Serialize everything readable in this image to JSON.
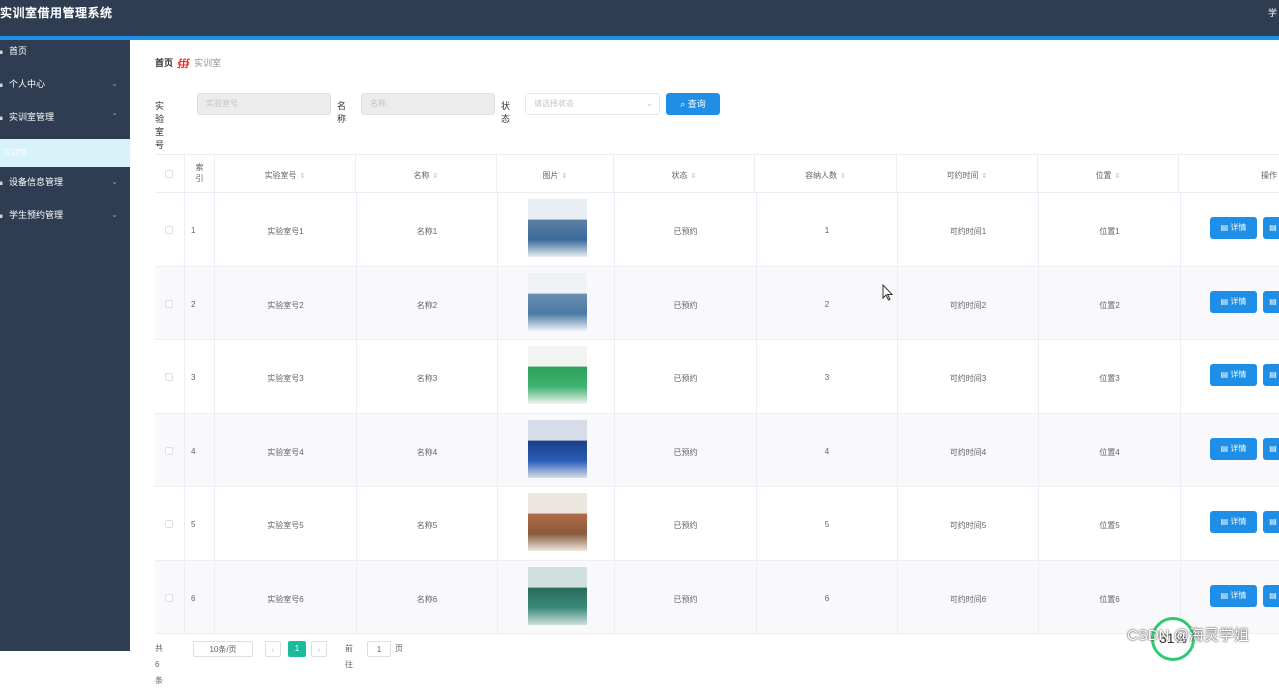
{
  "header": {
    "title": "实训室借用管理系统",
    "user": "学"
  },
  "sidebar": {
    "items": [
      {
        "label": "首页",
        "arrow": ""
      },
      {
        "label": "个人中心",
        "arrow": "⌄"
      },
      {
        "label": "实训室管理",
        "arrow": "⌃"
      },
      {
        "label": "设备信息管理",
        "arrow": "⌄"
      },
      {
        "label": "学生预约管理",
        "arrow": "⌄"
      }
    ],
    "active_sub": "实训室"
  },
  "breadcrumb": {
    "home": "首页",
    "current": "实训室"
  },
  "search": {
    "room_no_label": "实验室号",
    "room_no_placeholder": "实验室号",
    "name_label": "名称",
    "name_placeholder": "名称",
    "status_label": "状态",
    "status_placeholder": "请选择状态",
    "query_button": "查询"
  },
  "table": {
    "headers": [
      "索引",
      "实验室号",
      "名称",
      "图片",
      "状态",
      "容纳人数",
      "可约时间",
      "位置",
      "操作"
    ],
    "rows": [
      {
        "index": "1",
        "room_no": "实验室号1",
        "name": "名称1",
        "status": "已预约",
        "capacity": "1",
        "time": "可约时间1",
        "location": "位置1"
      },
      {
        "index": "2",
        "room_no": "实验室号2",
        "name": "名称2",
        "status": "已预约",
        "capacity": "2",
        "time": "可约时间2",
        "location": "位置2"
      },
      {
        "index": "3",
        "room_no": "实验室号3",
        "name": "名称3",
        "status": "已预约",
        "capacity": "3",
        "time": "可约时间3",
        "location": "位置3"
      },
      {
        "index": "4",
        "room_no": "实验室号4",
        "name": "名称4",
        "status": "已预约",
        "capacity": "4",
        "time": "可约时间4",
        "location": "位置4"
      },
      {
        "index": "5",
        "room_no": "实验室号5",
        "name": "名称5",
        "status": "已预约",
        "capacity": "5",
        "time": "可约时间5",
        "location": "位置5"
      },
      {
        "index": "6",
        "room_no": "实验室号6",
        "name": "名称6",
        "status": "已预约",
        "capacity": "6",
        "time": "可约时间6",
        "location": "位置6"
      }
    ],
    "detail_button": "详情"
  },
  "pager": {
    "total": "共 6 条",
    "page_size": "10条/页",
    "prev": "‹",
    "page": "1",
    "next": "›",
    "goto": "前往",
    "goto_value": "1",
    "page_unit": "页"
  },
  "overlay": {
    "watermark": "CSDN @海灵学姐",
    "badge": "31%"
  },
  "colors": {
    "header_bg": "#2e3d52",
    "accent": "#1e8ee6",
    "active_page": "#1abc9c"
  }
}
